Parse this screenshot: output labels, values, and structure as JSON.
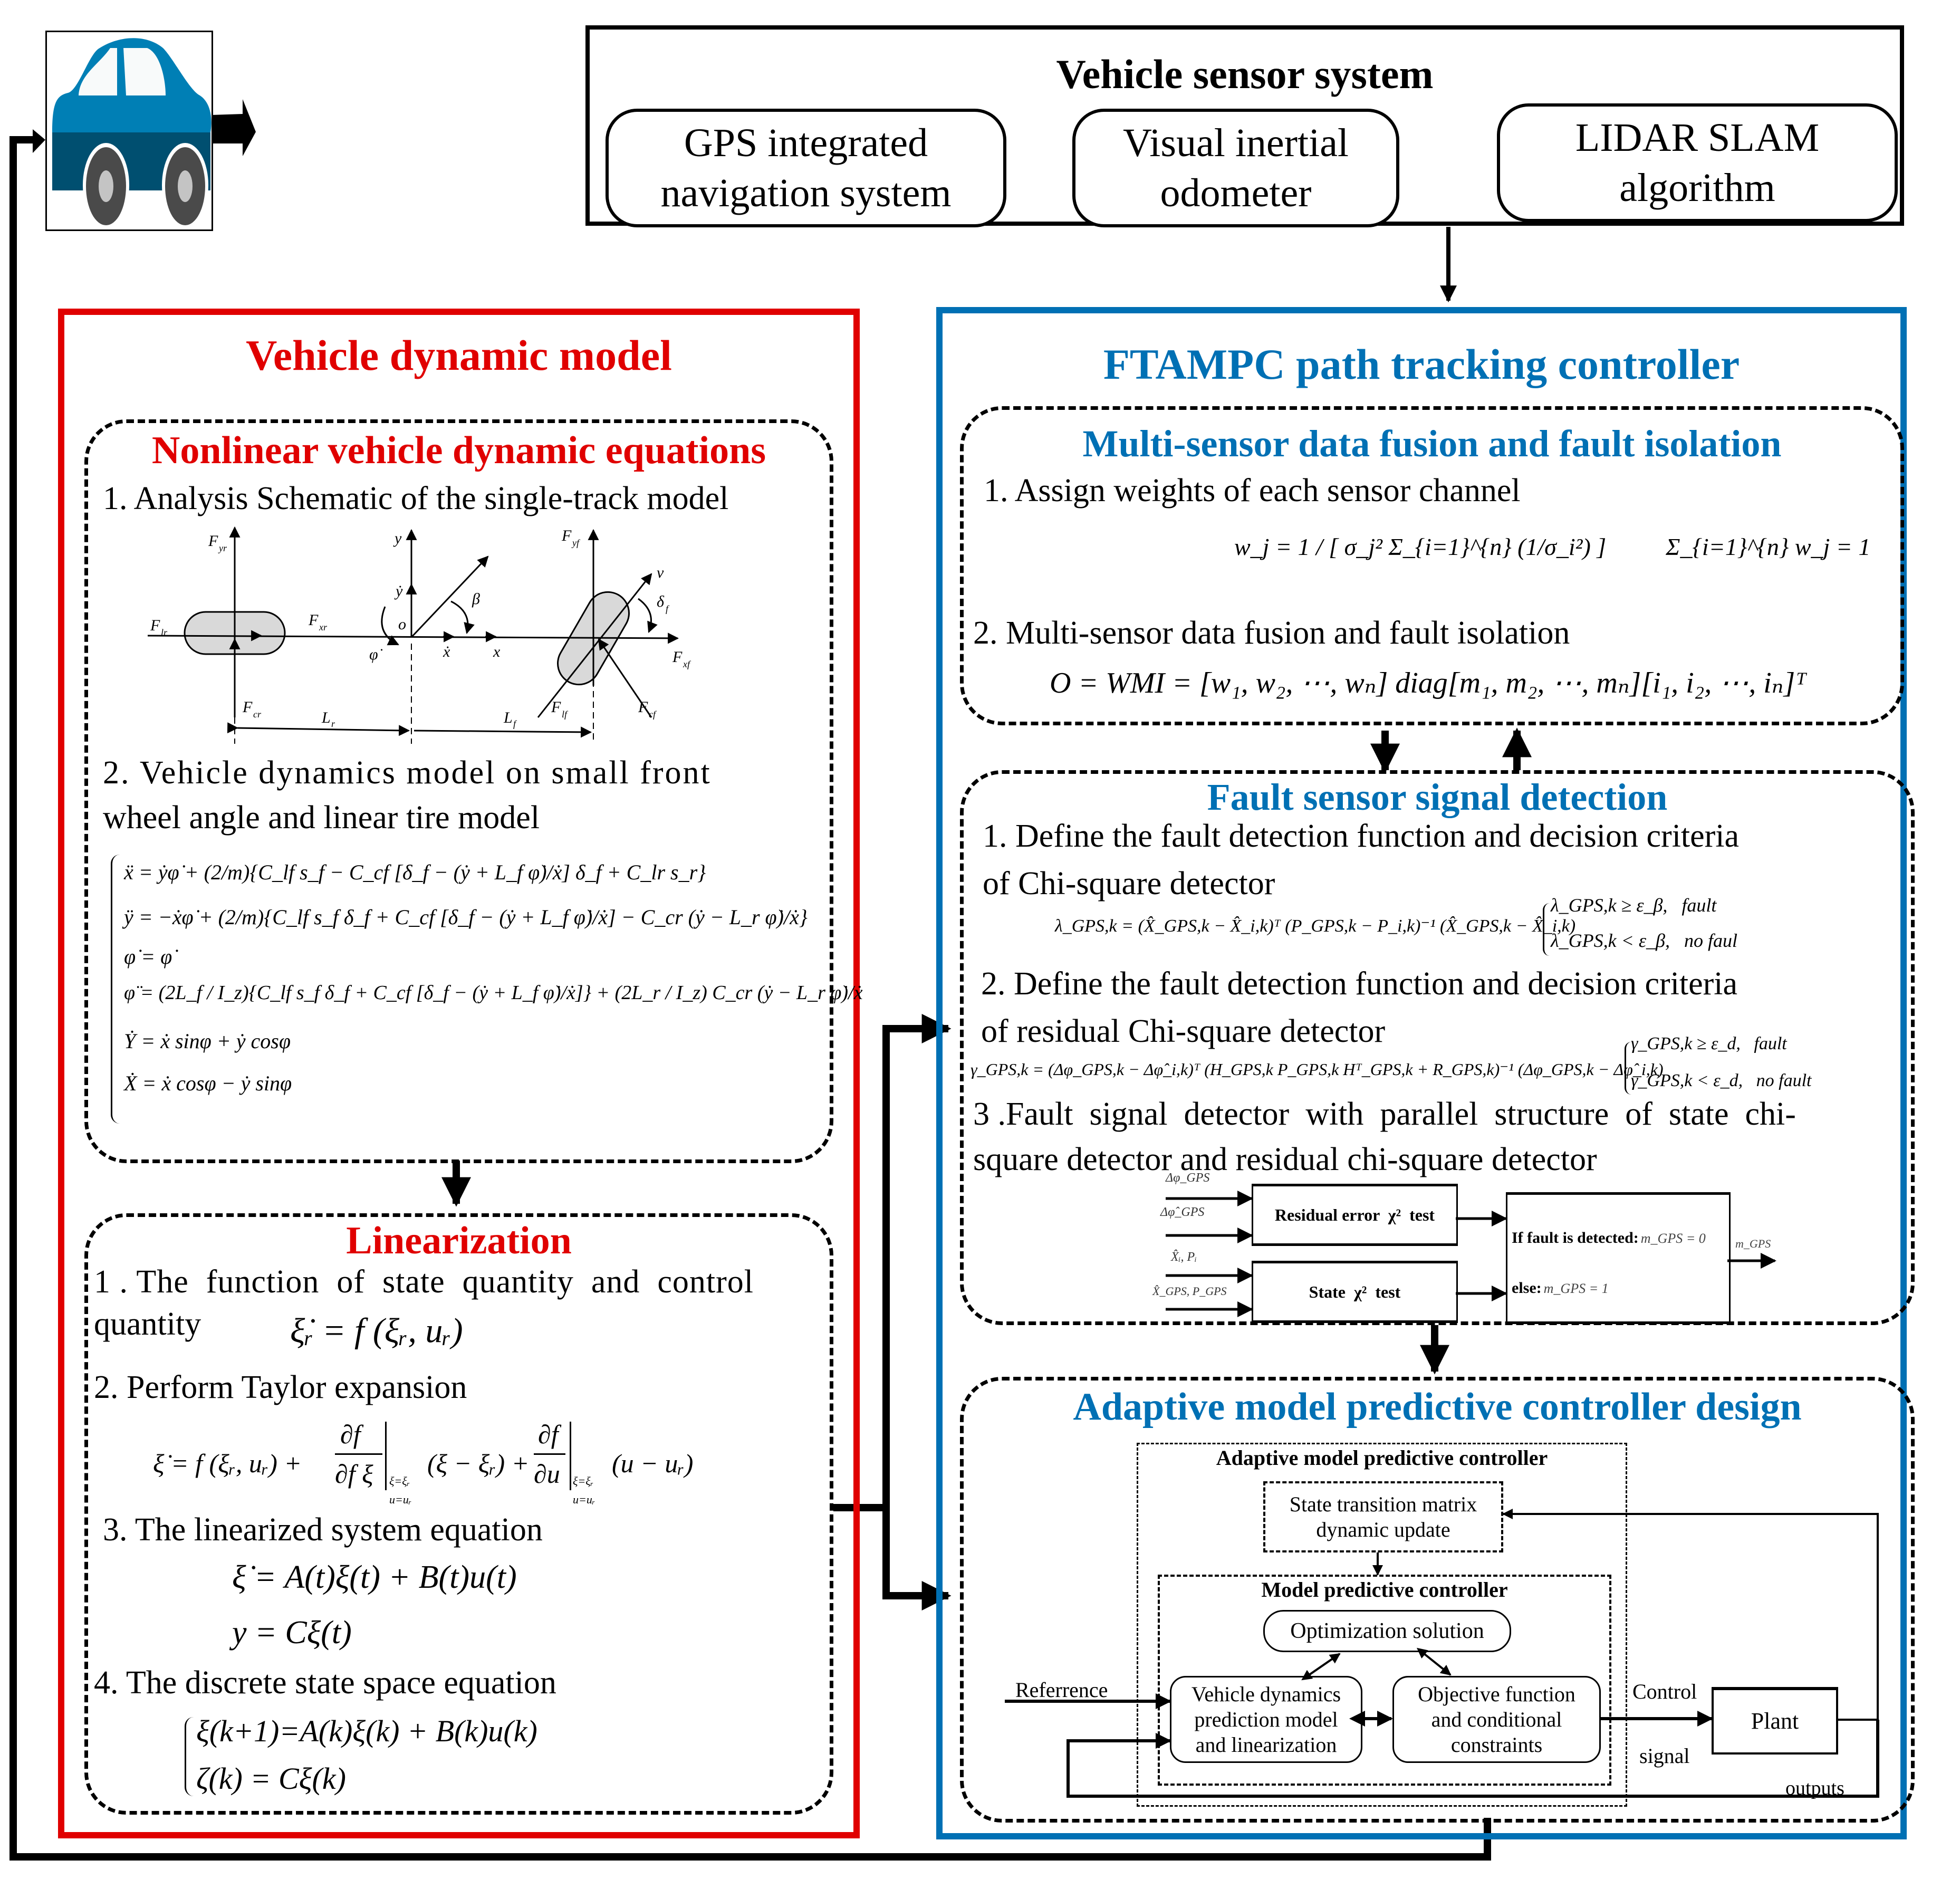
{
  "vehicle": {
    "icon": "car-icon",
    "colors": {
      "body_top": "#007fb5",
      "body_bottom": "#004f70",
      "tire": "#4a4a4a",
      "hub": "#c4c4c4",
      "window": "#f8fafa"
    }
  },
  "sensor_system": {
    "title": "Vehicle sensor system",
    "sensors": [
      {
        "line1": "GPS integrated",
        "line2": "navigation system"
      },
      {
        "line1": "Visual inertial",
        "line2": "odometer"
      },
      {
        "line1": "LIDAR SLAM",
        "line2": "algorithm"
      }
    ]
  },
  "colors": {
    "red": "#e00000",
    "blue": "#0070b4"
  },
  "dynamic_model": {
    "title": "Vehicle dynamic model",
    "nonlinear": {
      "title": "Nonlinear vehicle dynamic equations",
      "item1": "1. Analysis Schematic of the single-track model",
      "schematic_labels": {
        "Fyr": "F",
        "Fyr_sub": "yr",
        "Flr": "F",
        "Flr_sub": "lr",
        "Fxr": "F",
        "Fxr_sub": "xr",
        "Fcr": "F",
        "Fcr_sub": "cr",
        "y": "y",
        "ydot": "ẏ",
        "o": "o",
        "beta": "β",
        "phidot": "φ̇",
        "xdot": "ẋ",
        "x": "x",
        "Fyf": "F",
        "Fyf_sub": "yf",
        "v": "v",
        "delta": "δ",
        "delta_sub": "f",
        "Fxf": "F",
        "Fxf_sub": "xf",
        "Flf": "F",
        "Flf_sub": "lf",
        "Fcf": "F",
        "Fcf_sub": "cf",
        "Lr": "L",
        "Lr_sub": "r",
        "Lf": "L",
        "Lf_sub": "f"
      },
      "item2_line1": "2. Vehicle dynamics model on small front",
      "item2_line2": "wheel angle and linear tire model",
      "equations": [
        "ẍ = ẏφ̇ + (2/m){C_lf s_f − C_cf [δ_f − (ẏ + L_f φ̇)/ẋ] δ_f + C_lr s_r}",
        "ÿ = −ẋφ̇ + (2/m){C_lf s_f δ_f + C_cf [δ_f − (ẏ + L_f φ̇)/ẋ] − C_cr (ẏ − L_r φ̇)/ẋ}",
        "φ̇ = φ̇",
        "φ̈ = (2L_f / I_z){C_lf s_f δ_f + C_cf [δ_f − (ẏ + L_f φ̇)/ẋ]} + (2L_r / I_z) C_cr (ẏ − L_r φ̇)/ẋ",
        "Ẏ = ẋ sinφ + ẏ cosφ",
        "Ẋ = ẋ cosφ − ẏ sinφ"
      ]
    },
    "linearization": {
      "title": "Linearization",
      "item1_line1": "1 . The  function  of  state  quantity  and  control",
      "item1_line2": "quantity",
      "eq1": "ξ̇ᵣ = f (ξᵣ, uᵣ)",
      "item2": "2. Perform Taylor expansion",
      "eq2_lhs": "ξ̇ = f (ξᵣ, uᵣ) +",
      "eq2_frac1_num": "∂f",
      "eq2_frac1_den": "∂f ξ",
      "eq2_mid": "(ξ − ξᵣ) +",
      "eq2_frac2_num": "∂f",
      "eq2_frac2_den": "∂u",
      "eq2_end": "(u − uᵣ)",
      "eval_top": "ξ=ξᵣ",
      "eval_bottom": "u=uᵣ",
      "item3": "3. The linearized system equation",
      "eq3a": "ξ̇ = A(t)ξ(t) + B(t)u(t)",
      "eq3b": "y = Cξ(t)",
      "item4": "4. The discrete state space equation",
      "eq4a": "ξ(k+1)=A(k)ξ(k) + B(k)u(k)",
      "eq4b": "ζ(k) = Cξ(k)"
    }
  },
  "controller": {
    "title": "FTAMPC path tracking controller",
    "fusion": {
      "title": "Multi-sensor data fusion and fault isolation",
      "item1": "1. Assign weights of each sensor channel",
      "eq_w": "w_j = 1 / [ σ_j² Σ_{i=1}^{n} (1/σ_i²) ]",
      "eq_sum": "Σ_{i=1}^{n} w_j = 1",
      "item2": "2. Multi-sensor data fusion and fault isolation",
      "eq_o": "O = WMI = [w₁, w₂, ⋯, wₙ] diag[m₁, m₂, ⋯, mₙ][i₁, i₂, ⋯, iₙ]ᵀ"
    },
    "detection": {
      "title": "Fault sensor signal detection",
      "item1_line1": "1. Define the fault detection function and decision criteria",
      "item1_line2": "of Chi-square detector",
      "eq_lambda": "λ_GPS,k = (X̂_GPS,k − X̂_i,k)ᵀ (P_GPS,k − P_i,k)⁻¹ (X̂_GPS,k − X̂_i,k)",
      "crit_lambda": [
        "λ_GPS,k ≥ ε_β,   fault",
        "λ_GPS,k < ε_β,   no faul"
      ],
      "item2_line1": "2. Define the fault detection function and decision criteria",
      "item2_line2": "of residual Chi-square detector",
      "eq_gamma": "γ_GPS,k = (Δφ_GPS,k − Δφ̂_i,k)ᵀ (H_GPS,k P_GPS,k Hᵀ_GPS,k + R_GPS,k)⁻¹ (Δφ_GPS,k − Δφ̂_i,k)",
      "crit_gamma": [
        "γ_GPS,k ≥ ε_d,   fault",
        "γ_GPS,k < ε_d,   no fault"
      ],
      "item3_line1": "3 .Fault  signal  detector  with  parallel  structure  of  state  chi-",
      "item3_line2": "square detector and residual chi-square detector",
      "diagram": {
        "in1": "Δφ_GPS",
        "in2": "Δφ̂_GPS",
        "in3": "X̂ᵢ, Pᵢ",
        "in4": "X̂_GPS, P_GPS",
        "residual_box": "Residual error  χ²  test",
        "state_box": "State  χ²  test",
        "decision_line1_bold": "If fault is detected:",
        "decision_line1_math": "m_GPS = 0",
        "decision_line2_bold": "else:",
        "decision_line2_math": "m_GPS = 1",
        "output": "m_GPS"
      }
    },
    "ampc": {
      "title": "Adaptive model predictive controller design",
      "outer_label": "Adaptive model predictive controller",
      "stm_line1": "State transition matrix",
      "stm_line2": "dynamic update",
      "mpc_label": "Model predictive controller",
      "optimization": "Optimization solution",
      "vdm_lines": [
        "Vehicle dynamics",
        "prediction model",
        "and linearization"
      ],
      "obj_lines": [
        "Objective function",
        "and conditional",
        "constraints"
      ],
      "reference": "Referrence",
      "control_signal_line1": "Control",
      "control_signal_line2": "signal",
      "plant": "Plant",
      "outputs": "outputs"
    }
  }
}
